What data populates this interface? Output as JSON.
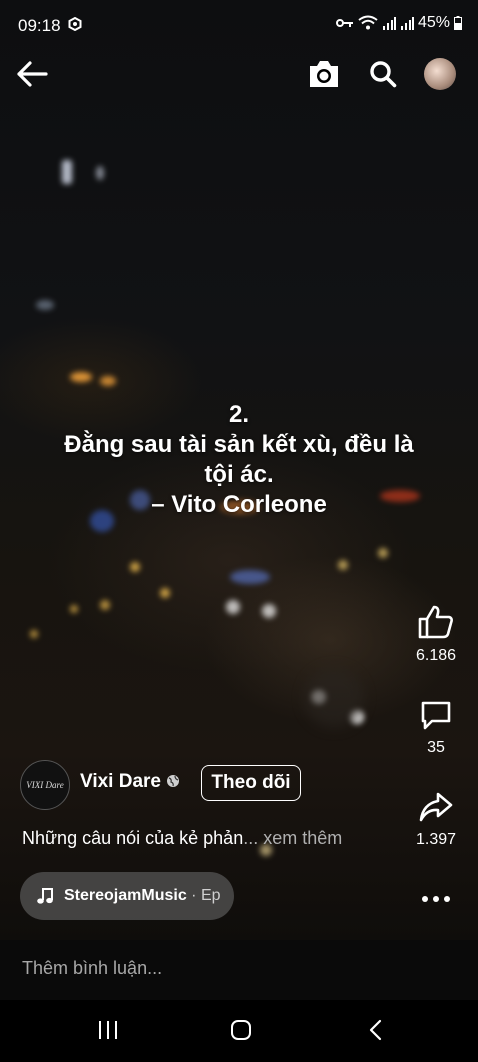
{
  "status_bar": {
    "time": "09:18",
    "battery": "45%"
  },
  "topbar": {
    "icons": [
      "back-arrow-icon",
      "camera-icon",
      "search-icon",
      "profile-avatar"
    ]
  },
  "quote": {
    "lines": [
      "2.",
      "Đằng sau tài sản kết xù, đều là",
      "tội ác.",
      "– Vito Corleone"
    ]
  },
  "actions": {
    "like_count": "6.186",
    "comment_count": "35",
    "share_count": "1.397"
  },
  "author": {
    "avatar_text": "VIXI Dare",
    "name": "Vixi Dare",
    "follow_label": "Theo dõi"
  },
  "caption": {
    "text": "Những câu nói của kẻ phản",
    "more": "... xem thêm"
  },
  "music": {
    "artist": "StereojamMusic",
    "suffix": " · Ep"
  },
  "comment": {
    "placeholder": "Thêm bình luận..."
  },
  "colors": {
    "background": "#000000",
    "text": "#ffffff",
    "muted": "#b0b0b0",
    "pill": "#5a5a5a"
  }
}
